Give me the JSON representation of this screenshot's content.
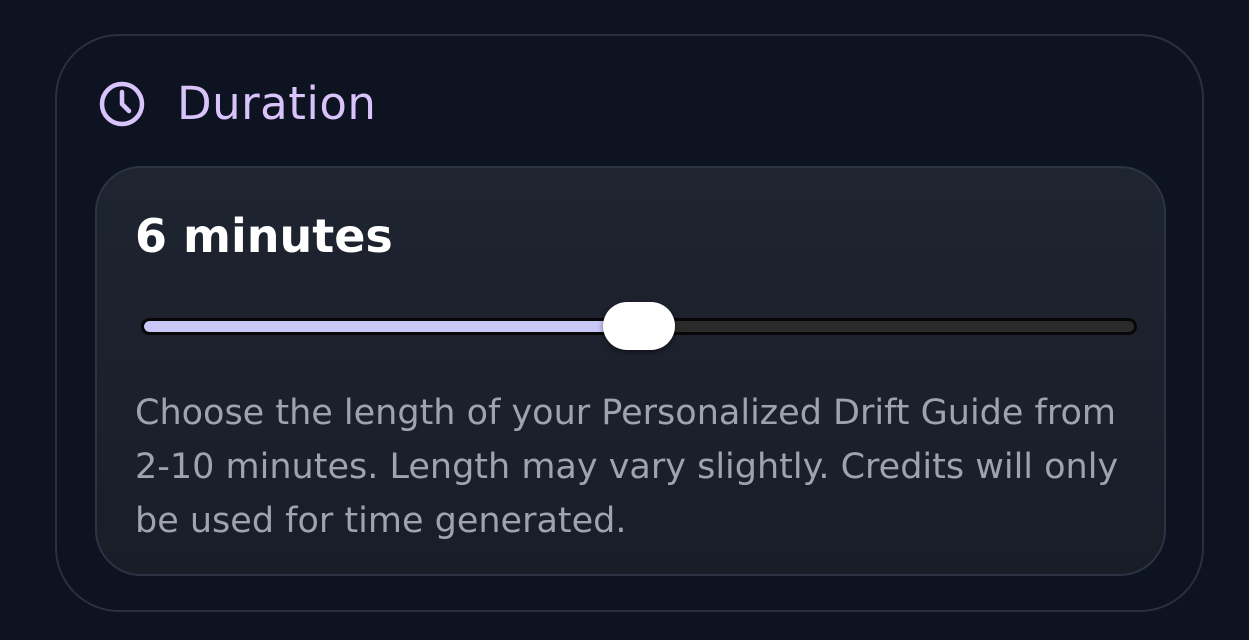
{
  "duration_section": {
    "title": "Duration",
    "icon": "clock-icon",
    "accent_color": "#d8c3fb",
    "value_label": "6 minutes",
    "slider": {
      "min": 2,
      "max": 10,
      "value": 6,
      "fill_color": "#c8c7f5",
      "track_color": "#2b2b2b",
      "thumb_color": "#ffffff"
    },
    "description": "Choose the length of your Personalized Drift Guide from 2-10 minutes. Length may vary slightly. Credits will only be used for time generated."
  }
}
